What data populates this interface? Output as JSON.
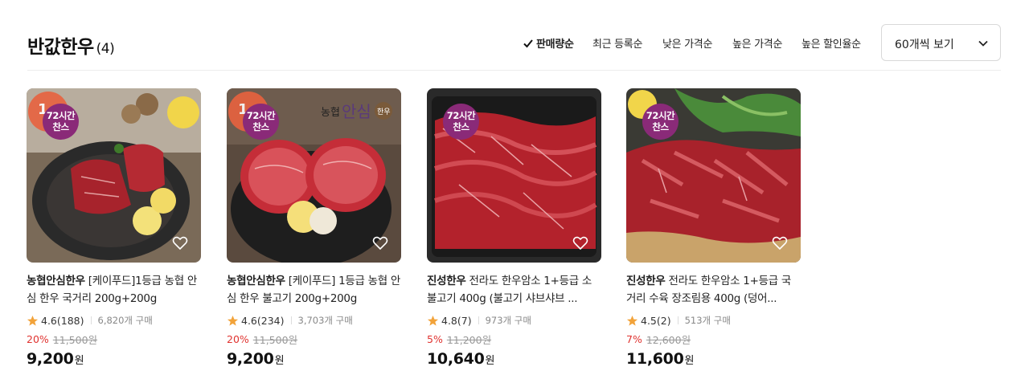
{
  "header": {
    "title": "반값한우",
    "count": "(4)"
  },
  "sort_options": [
    {
      "label": "판매량순",
      "active": true
    },
    {
      "label": "최근 등록순",
      "active": false
    },
    {
      "label": "낮은 가격순",
      "active": false
    },
    {
      "label": "높은 가격순",
      "active": false
    },
    {
      "label": "높은 할인율순",
      "active": false
    }
  ],
  "view_select": {
    "label": "60개씩 보기"
  },
  "products": [
    {
      "rank": "1",
      "badge_line1": "72시간",
      "badge_line2": "찬스",
      "brand_logo": "",
      "brand": "농협안심한우",
      "name": " [케이푸드]1등급 농협 안심 한우 국거리 200g+200g",
      "rating": "4.6(188)",
      "sold": "6,820개 구매",
      "discount": "20%",
      "original_price": "11,500원",
      "price": "9,200",
      "currency": "원"
    },
    {
      "rank": "1",
      "badge_line1": "72시간",
      "badge_line2": "찬스",
      "brand_logo": "농협안심한우",
      "brand": "농협안심한우",
      "name": " [케이푸드] 1등급 농협 안심 한우 불고기 200g+200g",
      "rating": "4.6(234)",
      "sold": "3,703개 구매",
      "discount": "20%",
      "original_price": "11,500원",
      "price": "9,200",
      "currency": "원"
    },
    {
      "rank": "",
      "badge_line1": "72시간",
      "badge_line2": "찬스",
      "brand_logo": "",
      "brand": "진성한우",
      "name": " 전라도 한우암소 1+등급 소불고기 400g (불고기 샤브샤브 ...",
      "rating": "4.8(7)",
      "sold": "973개 구매",
      "discount": "5%",
      "original_price": "11,200원",
      "price": "10,640",
      "currency": "원"
    },
    {
      "rank": "",
      "badge_line1": "72시간",
      "badge_line2": "찬스",
      "brand_logo": "",
      "brand": "진성한우",
      "name": " 전라도 한우암소 1+등급 국거리 수육 장조림용 400g (덩어...",
      "rating": "4.5(2)",
      "sold": "513개 구매",
      "discount": "7%",
      "original_price": "12,600원",
      "price": "11,600",
      "currency": "원"
    }
  ],
  "icons": {
    "check": "check-icon",
    "chevron": "chevron-down-icon",
    "star": "star-icon",
    "heart": "heart-icon"
  },
  "colors": {
    "discount": "#e0322f",
    "badge": "#8a2a78",
    "rank": "#e8623f",
    "star": "#f2a33a"
  }
}
